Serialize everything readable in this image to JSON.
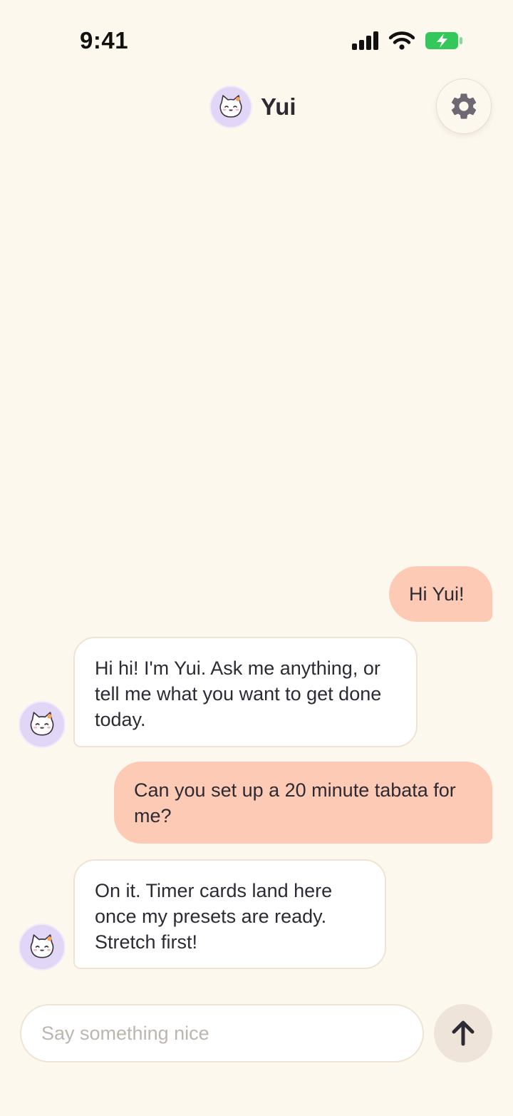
{
  "status_bar": {
    "time": "9:41",
    "icons": [
      "signal-icon",
      "wifi-icon",
      "battery-charging-icon"
    ],
    "battery_color": "#34c759"
  },
  "header": {
    "title": "Yui",
    "avatar_icon": "cat-face-icon",
    "settings_icon": "gear-icon"
  },
  "messages": [
    {
      "role": "user",
      "text": "Hi Yui!"
    },
    {
      "role": "bot",
      "text": "Hi hi! I'm Yui. Ask me anything, or tell me what you want to get done today."
    },
    {
      "role": "user",
      "text": "Can you set up a 20 minute tabata for me?"
    },
    {
      "role": "bot",
      "text": "On it. Timer cards land here once my presets are ready. Stretch first!"
    }
  ],
  "composer": {
    "placeholder": "Say something nice",
    "value": "",
    "send_icon": "arrow-up-icon"
  },
  "colors": {
    "background": "#fdf8ee",
    "user_bubble": "#fdcab5",
    "bot_bubble": "#ffffff",
    "bot_border": "#efe4d4",
    "avatar_bg": "#e2d6f7",
    "send_button": "#efe4d9",
    "text": "#2e2a33",
    "icon_gray": "#6e6872"
  }
}
